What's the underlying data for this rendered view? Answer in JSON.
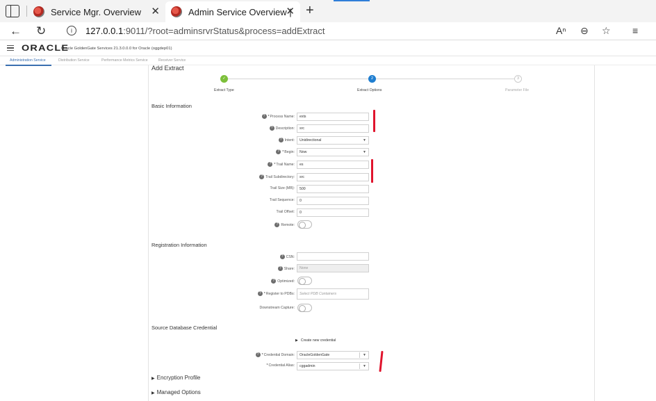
{
  "browser": {
    "tabs": [
      {
        "title": "Service Mgr. Overview",
        "close": "✕"
      },
      {
        "title": "Admin Service Overview | Add Ext",
        "close": "✕"
      }
    ],
    "new_tab": "+",
    "url_host": "127.0.0.1",
    "url_rest": ":9011/?root=adminsrvrStatus&process=addExtract",
    "icons": [
      "tab-actions-icon",
      "back-arrow-icon",
      "refresh-icon",
      "info-icon",
      "read-aloud-icon",
      "zoom-icon",
      "favorite-star-icon",
      "favorites-list-icon"
    ]
  },
  "app": {
    "logo": "ORACLE",
    "product": "Oracle GoldenGate Services 21.3.0.0.0 for Oracle (oggdep01)",
    "nav_tabs": [
      "Administration Service",
      "Distribution Service",
      "Performance Metrics Service",
      "Receiver Service"
    ]
  },
  "page": {
    "title": "Add Extract",
    "steps": [
      {
        "number": "✓",
        "label": "Extract Type",
        "state": "done"
      },
      {
        "number": "2",
        "label": "Extract Options",
        "state": "current"
      },
      {
        "number": "3",
        "label": "Parameter File",
        "state": "future"
      }
    ],
    "basic": {
      "title": "Basic Information",
      "process_name_label": "Process Name:",
      "process_name_value": "exts",
      "description_label": "Description:",
      "description_value": "src",
      "intent_label": "Intent:",
      "intent_value": "Unidirectional",
      "begin_label": "Begin:",
      "begin_value": "Now",
      "trail_name_label": "Trail Name:",
      "trail_name_value": "es",
      "trail_subdir_label": "Trail Subdirectory:",
      "trail_subdir_value": "src",
      "trail_size_label": "Trail Size (MB):",
      "trail_size_value": "500",
      "trail_sequence_label": "Trail Sequence:",
      "trail_sequence_value": "0",
      "trail_offset_label": "Trail Offset:",
      "trail_offset_value": "0",
      "remote_label": "Remote:"
    },
    "registration": {
      "title": "Registration Information",
      "csn_label": "CSN:",
      "csn_value": "",
      "share_label": "Share:",
      "share_value": "None",
      "optimized_label": "Optimized:",
      "register_pdbs_label": "Register to PDBs:",
      "register_pdbs_placeholder": "Select PDB Containers",
      "downstream_label": "Downstream Capture:"
    },
    "credential": {
      "title": "Source Database Credential",
      "create_new": "Create new credential",
      "domain_label": "Credential Domain:",
      "domain_value": "OracleGoldenGate",
      "alias_label": "Credential Alias:",
      "alias_value": "cggadmin"
    },
    "expanders": [
      "Encryption Profile",
      "Managed Options"
    ],
    "help_glyph": "?",
    "required_glyph": "*",
    "annotation_color": "#e0142d"
  }
}
